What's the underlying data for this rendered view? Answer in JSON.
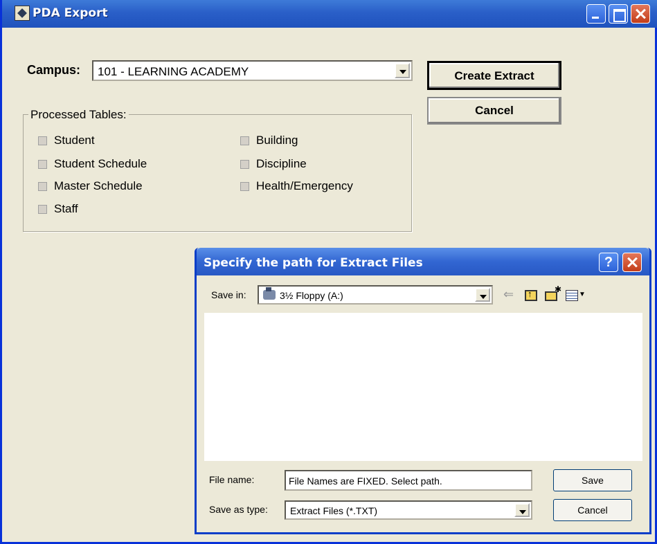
{
  "window": {
    "title": "PDA Export"
  },
  "campus": {
    "label": "Campus:",
    "value": "101 - LEARNING ACADEMY"
  },
  "buttons": {
    "create": "Create Extract",
    "cancel": "Cancel"
  },
  "processed": {
    "title": "Processed Tables:",
    "items": [
      {
        "label": "Student",
        "checked": false
      },
      {
        "label": "Student Schedule",
        "checked": false
      },
      {
        "label": "Master Schedule",
        "checked": false
      },
      {
        "label": "Staff",
        "checked": false
      },
      {
        "label": "Building",
        "checked": false
      },
      {
        "label": "Discipline",
        "checked": false
      },
      {
        "label": "Health/Emergency",
        "checked": false
      }
    ]
  },
  "dialog": {
    "title": "Specify the path for Extract Files",
    "help": "?",
    "save_in_label": "Save in:",
    "save_in_value": "3½ Floppy (A:)",
    "file_name_label": "File name:",
    "file_name_value": "File Names are FIXED. Select path.",
    "save_type_label": "Save as type:",
    "save_type_value": "Extract Files (*.TXT)",
    "save_button": "Save",
    "cancel_button": "Cancel"
  }
}
